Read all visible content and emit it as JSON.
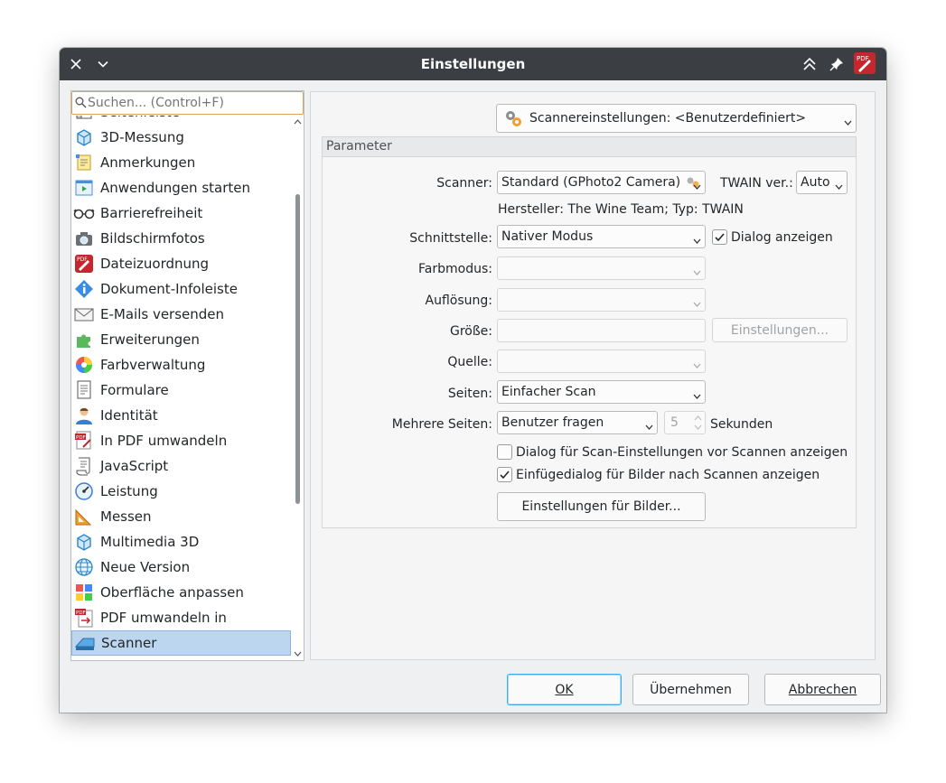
{
  "window": {
    "title": "Einstellungen"
  },
  "search": {
    "placeholder": "Suchen... (Control+F)"
  },
  "sidebar": {
    "items": [
      {
        "label": "Seitenleiste",
        "icon": "sidebar-icon"
      },
      {
        "label": "3D-Messung",
        "icon": "cube-measure-icon"
      },
      {
        "label": "Anmerkungen",
        "icon": "annotation-icon"
      },
      {
        "label": "Anwendungen starten",
        "icon": "launch-app-icon"
      },
      {
        "label": "Barrierefreiheit",
        "icon": "glasses-icon"
      },
      {
        "label": "Bildschirmfotos",
        "icon": "camera-icon"
      },
      {
        "label": "Dateizuordnung",
        "icon": "pdf-file-icon"
      },
      {
        "label": "Dokument-Infoleiste",
        "icon": "info-icon"
      },
      {
        "label": "E-Mails versenden",
        "icon": "mail-icon"
      },
      {
        "label": "Erweiterungen",
        "icon": "puzzle-icon"
      },
      {
        "label": "Farbverwaltung",
        "icon": "color-wheel-icon"
      },
      {
        "label": "Formulare",
        "icon": "form-icon"
      },
      {
        "label": "Identität",
        "icon": "user-icon"
      },
      {
        "label": "In PDF umwandeln",
        "icon": "pdf-convert-icon"
      },
      {
        "label": "JavaScript",
        "icon": "script-icon"
      },
      {
        "label": "Leistung",
        "icon": "gauge-icon"
      },
      {
        "label": "Messen",
        "icon": "ruler-icon"
      },
      {
        "label": "Multimedia 3D",
        "icon": "cube-icon"
      },
      {
        "label": "Neue Version",
        "icon": "globe-icon"
      },
      {
        "label": "Oberfläche anpassen",
        "icon": "palette-grid-icon"
      },
      {
        "label": "PDF umwandeln in",
        "icon": "pdf-export-icon"
      },
      {
        "label": "Scanner",
        "icon": "scanner-icon"
      }
    ],
    "selected": "Scanner"
  },
  "preset": {
    "value": "Scannereinstellungen: <Benutzerdefiniert>"
  },
  "group": {
    "title": "Parameter"
  },
  "form": {
    "scanner_label": "Scanner:",
    "scanner_value": "Standard (GPhoto2 Camera)",
    "twain_label": "TWAIN ver.:",
    "twain_value": "Auto",
    "manufacturer": "Hersteller: The Wine Team; Typ: TWAIN",
    "interface_label": "Schnittstelle:",
    "interface_value": "Nativer Modus",
    "show_dialog_label": "Dialog anzeigen",
    "color_label": "Farbmodus:",
    "resolution_label": "Auflösung:",
    "size_label": "Größe:",
    "size_settings_button": "Einstellungen...",
    "source_label": "Quelle:",
    "pages_label": "Seiten:",
    "pages_value": "Einfacher Scan",
    "multi_label": "Mehrere Seiten:",
    "multi_value": "Benutzer fragen",
    "seconds_value": "5",
    "seconds_label": "Sekunden",
    "scan_dialog_label": "Dialog für Scan-Einstellungen vor Scannen anzeigen",
    "insert_dialog_label": "Einfügedialog für Bilder nach Scannen anzeigen",
    "image_settings_button": "Einstellungen für Bilder..."
  },
  "checks": {
    "show_dialog": true,
    "scan_dialog": false,
    "insert_dialog": true
  },
  "buttons": {
    "ok": "OK",
    "apply": "Übernehmen",
    "cancel": "Abbrechen"
  },
  "colors": {
    "titlebar": "#3b3f44",
    "selection": "#bdd6ef",
    "focus": "#3daee9",
    "search_border": "#d6a75a"
  }
}
